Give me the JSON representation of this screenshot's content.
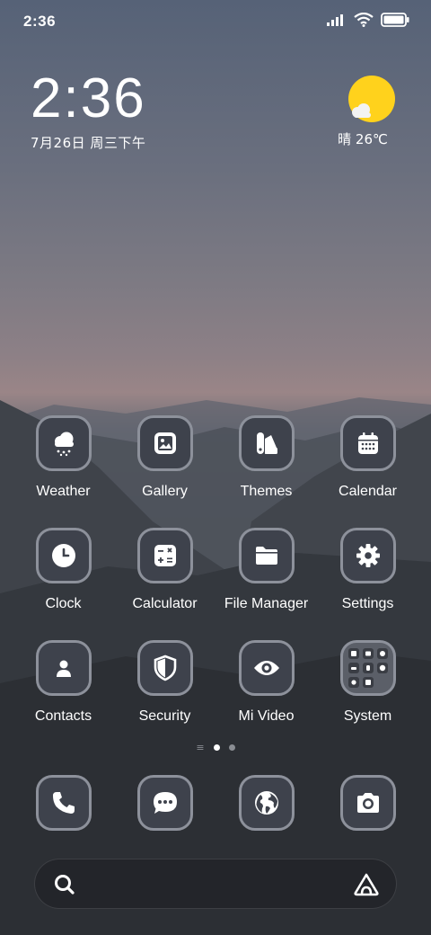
{
  "status_bar": {
    "time": "2:36",
    "icons": [
      "signal-icon",
      "wifi-icon",
      "battery-icon"
    ]
  },
  "clock_widget": {
    "time": "2:36",
    "date": "7月26日 周三下午"
  },
  "weather_widget": {
    "condition_icon": "sun-cloud-icon",
    "text": "晴 26℃"
  },
  "apps": [
    {
      "label": "Weather",
      "icon": "weather-icon"
    },
    {
      "label": "Gallery",
      "icon": "gallery-icon"
    },
    {
      "label": "Themes",
      "icon": "themes-icon"
    },
    {
      "label": "Calendar",
      "icon": "calendar-icon"
    },
    {
      "label": "Clock",
      "icon": "clock-icon"
    },
    {
      "label": "Calculator",
      "icon": "calculator-icon"
    },
    {
      "label": "File Manager",
      "icon": "folder-icon"
    },
    {
      "label": "Settings",
      "icon": "gear-icon"
    },
    {
      "label": "Contacts",
      "icon": "contacts-icon"
    },
    {
      "label": "Security",
      "icon": "shield-icon"
    },
    {
      "label": "Mi Video",
      "icon": "eye-icon"
    },
    {
      "label": "System",
      "icon": "folder-grid-icon"
    }
  ],
  "page_indicator": {
    "pages": 2,
    "current": 1
  },
  "dock": [
    {
      "icon": "phone-icon"
    },
    {
      "icon": "message-icon"
    },
    {
      "icon": "browser-icon"
    },
    {
      "icon": "camera-icon"
    }
  ],
  "search_bar": {
    "left_icon": "search-icon",
    "right_icon": "assistant-icon"
  },
  "colors": {
    "sun": "#ffd21c",
    "icon_bg": "#3e424c",
    "icon_border": "#8d919b"
  }
}
